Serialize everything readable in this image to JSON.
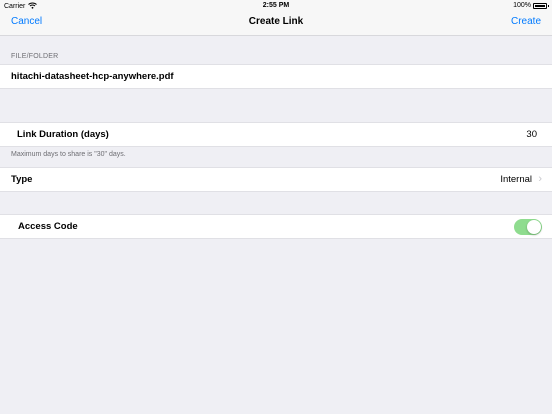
{
  "status_bar": {
    "carrier": "Carrier",
    "wifi_icon": "wifi-icon",
    "time": "2:55 PM",
    "battery_percent": "100%",
    "battery_icon": "battery-icon"
  },
  "nav": {
    "cancel_label": "Cancel",
    "title": "Create Link",
    "create_label": "Create",
    "accent_color": "#007aff"
  },
  "file_section": {
    "header": "FILE/FOLDER",
    "filename": "hitachi-datasheet-hcp-anywhere.pdf"
  },
  "duration": {
    "label": "Link Duration (days)",
    "value": "30",
    "footer": "Maximum days to share is \"30\" days."
  },
  "type": {
    "label": "Type",
    "value": "Internal",
    "chevron_icon": "chevron-right-icon"
  },
  "access_code": {
    "label": "Access Code",
    "enabled": true,
    "toggle_color": "#8fdc8f"
  }
}
